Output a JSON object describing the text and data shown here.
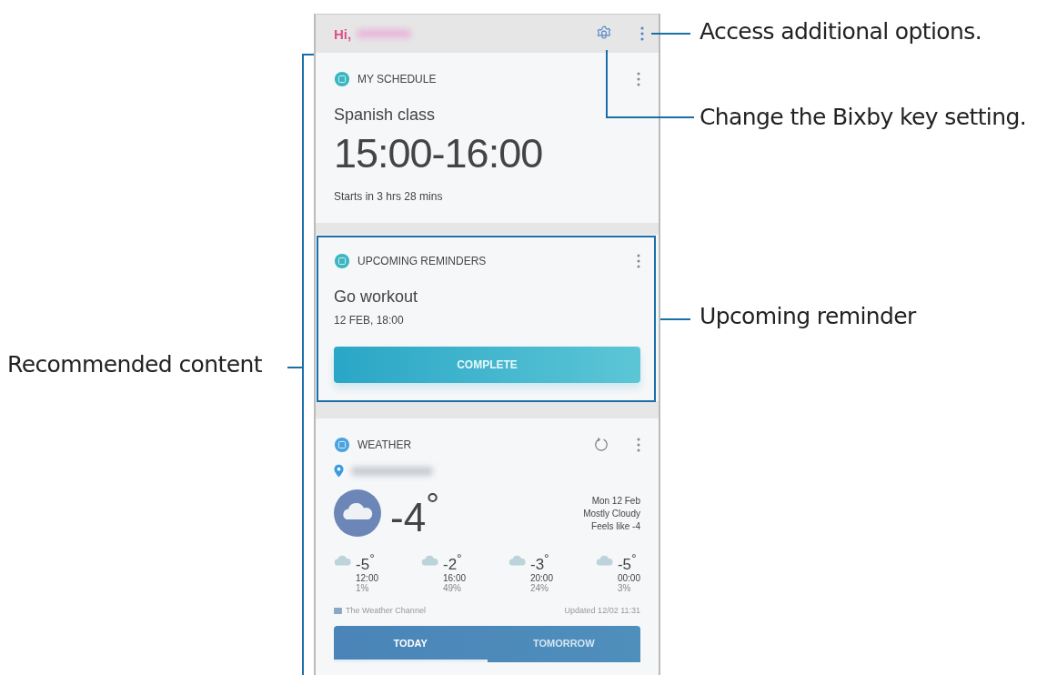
{
  "phone": {
    "header": {
      "greeting": "Hi,"
    },
    "cards": [
      {
        "kind": "schedule",
        "title": "MY SCHEDULE",
        "event": "Spanish class",
        "time": "15:00-16:00",
        "note": "Starts in 3 hrs 28 mins"
      },
      {
        "kind": "reminder",
        "title": "UPCOMING REMINDERS",
        "event": "Go workout",
        "time": "12 FEB, 18:00",
        "button": "COMPLETE"
      },
      {
        "kind": "weather",
        "title": "WEATHER",
        "temperature": "-4$^{°}$",
        "details": [
          "Mon 12 Feb",
          "Mostly Cloudy",
          "Feels like -4"
        ],
        "hourly": [
          {
            "temp": "-5$^{°}$",
            "time": "12:00",
            "chance": "1%"
          },
          {
            "temp": "-2$^{°}$",
            "time": "16:00",
            "chance": "49%"
          },
          {
            "temp": "-3$^{°}$",
            "time": "20:00",
            "chance": "24%"
          },
          {
            "temp": "-5$^{°}$",
            "time": "00:00",
            "chance": "3%"
          }
        ],
        "source": "The Weather Channel",
        "updated": "Updated 12/02 11:31",
        "tabs": [
          {
            "label": "TODAY",
            "selected": true
          },
          {
            "label": "TOMORROW",
            "selected": false
          }
        ]
      }
    ]
  },
  "callouts": [
    {
      "text": "Access additional options."
    },
    {
      "text": "Change the Bixby key setting."
    },
    {
      "text": "Upcoming reminder"
    },
    {
      "text": "Recommended content"
    }
  ]
}
